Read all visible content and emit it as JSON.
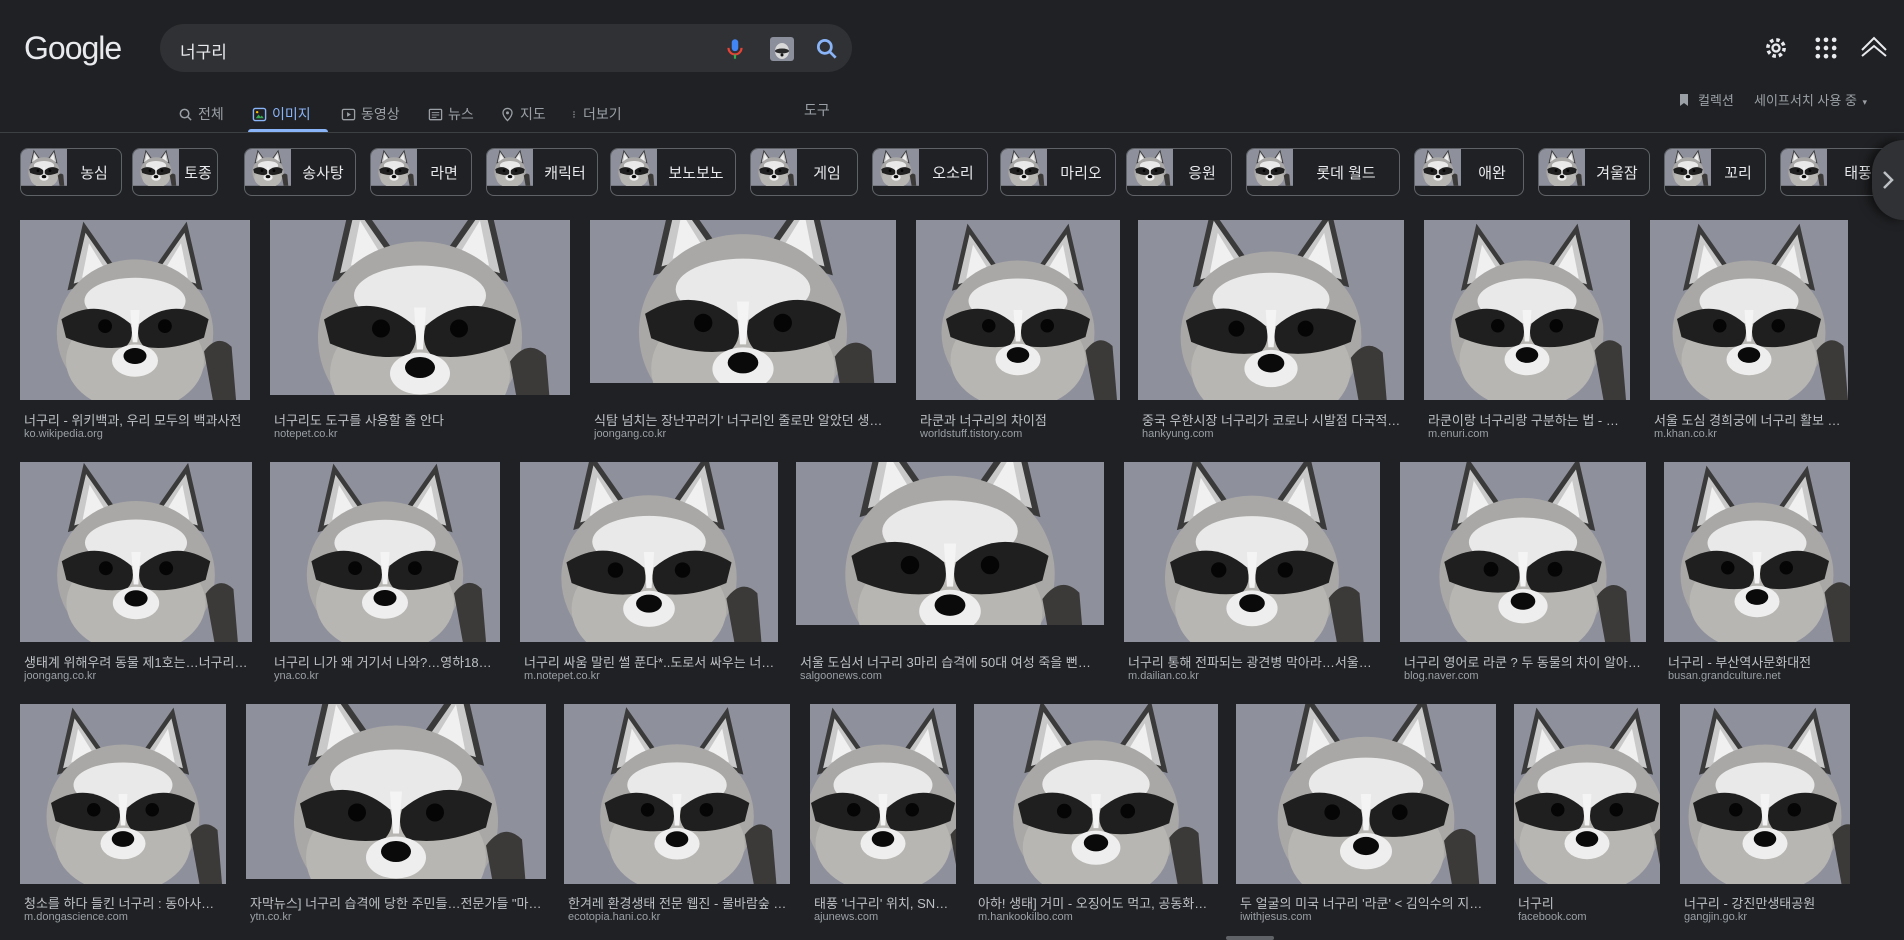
{
  "brand": {
    "logo_text": "Google"
  },
  "search": {
    "query": "너구리"
  },
  "tabs": [
    {
      "label": "전체",
      "icon": "search-icon"
    },
    {
      "label": "이미지",
      "icon": "image-icon",
      "active": true
    },
    {
      "label": "동영상",
      "icon": "video-icon"
    },
    {
      "label": "뉴스",
      "icon": "news-icon"
    },
    {
      "label": "지도",
      "icon": "map-pin-icon"
    },
    {
      "label": "더보기",
      "icon": "more-vertical-icon"
    }
  ],
  "tools_label": "도구",
  "collection_label": "컬렉션",
  "safesearch_label": "세이프서치 사용 중",
  "chips": [
    "농심",
    "토종",
    "송사탕",
    "라면",
    "캐릭터",
    "보노보노",
    "게임",
    "오소리",
    "마리오",
    "응원",
    "롯데 월드",
    "애완",
    "겨울잠",
    "꼬리",
    "태풍"
  ],
  "results": [
    [
      {
        "title": "너구리 - 위키백과, 우리 모두의 백과사전",
        "source": "ko.wikipedia.org"
      },
      {
        "title": "너구리도 도구를 사용할 줄 안다",
        "source": "notepet.co.kr"
      },
      {
        "title": "식탐 넘치는 장난꾸러기' 너구리인 줄로만 알았던 생물…",
        "source": "joongang.co.kr"
      },
      {
        "title": "라쿤과 너구리의 차이점",
        "source": "worldstuff.tistory.com"
      },
      {
        "title": "중국 우한시장 너구리가 코로나 시발점 다국적…",
        "source": "hankyung.com"
      },
      {
        "title": "라쿤이랑 너구리랑 구분하는 법 - …",
        "source": "m.enuri.com"
      },
      {
        "title": "서울 도심 경희궁에 너구리 활보 장면 포…",
        "source": "m.khan.co.kr"
      }
    ],
    [
      {
        "title": "생태계 위해우려 동물 제1호는…너구리 …",
        "source": "joongang.co.kr"
      },
      {
        "title": "너구리 니가 왜 거기서 나와?…영하18도…",
        "source": "yna.co.kr"
      },
      {
        "title": "너구리 싸움 말린 썰 푼다*..도로서 싸우는 너…",
        "source": "m.notepet.co.kr"
      },
      {
        "title": "서울 도심서 너구리 3마리 습격에 50대 여성 죽을 뻔했…",
        "source": "salgoonews.com"
      },
      {
        "title": "너구리 통해 전파되는 광견병 막아라…서울…",
        "source": "m.dailian.co.kr"
      },
      {
        "title": "너구리 영어로 라쿤 ? 두 동물의 차이 알아…",
        "source": "blog.naver.com"
      },
      {
        "title": "너구리 - 부산역사문화대전",
        "source": "busan.grandculture.net"
      }
    ],
    [
      {
        "title": "청소를 하다 들킨 너구리 : 동아사…",
        "source": "m.dongascience.com"
      },
      {
        "title": "자막뉴스] 너구리 습격에 당한 주민들…전문가들 \"마…",
        "source": "ytn.co.kr"
      },
      {
        "title": "한겨레 환경생태 전문 웹진 - 물바람숲 …",
        "source": "ecotopia.hani.co.kr"
      },
      {
        "title": "태풍 '너구리' 위치, SNS…",
        "source": "ajunews.com"
      },
      {
        "title": "아하! 생태] 거미 - 오징어도 먹고, 공동화…",
        "source": "m.hankookilbo.com"
      },
      {
        "title": "두 얼굴의 미국 너구리 '라쿤' < 김익수의 지속…",
        "source": "iwithjesus.com"
      },
      {
        "title": "너구리",
        "source": "facebook.com"
      },
      {
        "title": "너구리 - 강진만생태공원",
        "source": "gangjin.go.kr"
      }
    ]
  ],
  "colors": {
    "background": "#202124",
    "accent": "#8ab4f8",
    "text": "#bdc1c6",
    "searchbox": "#303134"
  }
}
